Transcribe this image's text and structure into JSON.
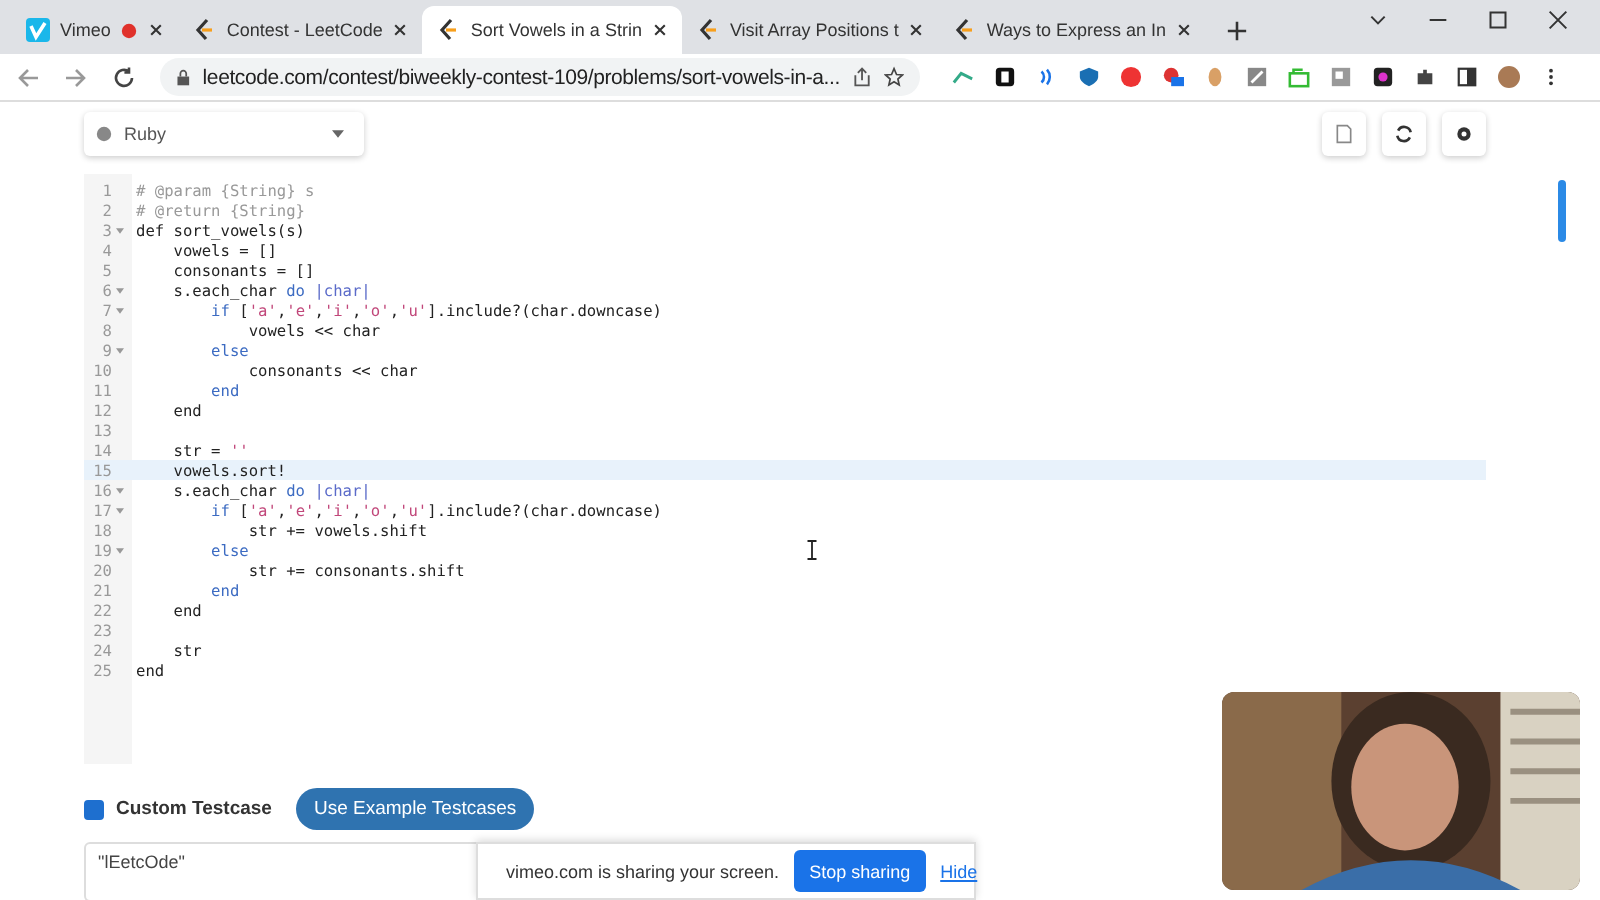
{
  "browser": {
    "tabs": [
      {
        "title": "Vimeo",
        "kind": "video",
        "selected": false,
        "recording": true
      },
      {
        "title": "Contest - LeetCode",
        "kind": "contest",
        "selected": false,
        "recording": false
      },
      {
        "title": "Sort Vowels in a Strin",
        "kind": "contest",
        "selected": true,
        "recording": false
      },
      {
        "title": "Visit Array Positions t",
        "kind": "contest",
        "selected": false,
        "recording": false
      },
      {
        "title": "Ways to Express an In",
        "kind": "contest",
        "selected": false,
        "recording": false
      }
    ],
    "address": "leetcode.com/contest/biweekly-contest-109/problems/sort-vowels-in-a..."
  },
  "toolbar": {
    "language": "Ruby"
  },
  "editor": {
    "lines": [
      {
        "number": "1",
        "fold": false,
        "active": false,
        "segments": [
          {
            "text": "# @param {String} s",
            "kind": "comment"
          }
        ]
      },
      {
        "number": "2",
        "fold": false,
        "active": false,
        "segments": [
          {
            "text": "# @return {String}",
            "kind": "comment"
          }
        ]
      },
      {
        "number": "3",
        "fold": true,
        "active": false,
        "segments": [
          {
            "text": "def sort_vowels(s)",
            "kind": "plain"
          }
        ]
      },
      {
        "number": "4",
        "fold": false,
        "active": false,
        "segments": [
          {
            "text": "    vowels = []",
            "kind": "plain"
          }
        ]
      },
      {
        "number": "5",
        "fold": false,
        "active": false,
        "segments": [
          {
            "text": "    consonants = []",
            "kind": "plain"
          }
        ]
      },
      {
        "number": "6",
        "fold": true,
        "active": false,
        "segments": [
          {
            "text": "    s.each_char ",
            "kind": "plain"
          },
          {
            "text": "do",
            "kind": "keyword"
          },
          {
            "text": " |char|",
            "kind": "variable"
          }
        ]
      },
      {
        "number": "7",
        "fold": true,
        "active": false,
        "segments": [
          {
            "text": "        if",
            "kind": "keyword"
          },
          {
            "text": " [",
            "kind": "plain"
          },
          {
            "text": "'a'",
            "kind": "string"
          },
          {
            "text": ",",
            "kind": "plain"
          },
          {
            "text": "'e'",
            "kind": "string"
          },
          {
            "text": ",",
            "kind": "plain"
          },
          {
            "text": "'i'",
            "kind": "string"
          },
          {
            "text": ",",
            "kind": "plain"
          },
          {
            "text": "'o'",
            "kind": "string"
          },
          {
            "text": ",",
            "kind": "plain"
          },
          {
            "text": "'u'",
            "kind": "string"
          },
          {
            "text": "].include?(char.downcase)",
            "kind": "plain"
          }
        ]
      },
      {
        "number": "8",
        "fold": false,
        "active": false,
        "segments": [
          {
            "text": "            vowels << char",
            "kind": "plain"
          }
        ]
      },
      {
        "number": "9",
        "fold": true,
        "active": false,
        "segments": [
          {
            "text": "        else",
            "kind": "keyword"
          }
        ]
      },
      {
        "number": "10",
        "fold": false,
        "active": false,
        "segments": [
          {
            "text": "            consonants << char",
            "kind": "plain"
          }
        ]
      },
      {
        "number": "11",
        "fold": false,
        "active": false,
        "segments": [
          {
            "text": "        end",
            "kind": "keyword"
          }
        ]
      },
      {
        "number": "12",
        "fold": false,
        "active": false,
        "segments": [
          {
            "text": "    end",
            "kind": "plain"
          }
        ]
      },
      {
        "number": "13",
        "fold": false,
        "active": false
      },
      {
        "number": "14",
        "fold": false,
        "active": false,
        "segments": [
          {
            "text": "    str = ",
            "kind": "plain"
          },
          {
            "text": "''",
            "kind": "string"
          }
        ]
      },
      {
        "number": "15",
        "fold": false,
        "active": true,
        "segments": [
          {
            "text": "    vowels.sort!",
            "kind": "plain"
          }
        ]
      },
      {
        "number": "16",
        "fold": true,
        "active": false,
        "segments": [
          {
            "text": "    s.each_char ",
            "kind": "plain"
          },
          {
            "text": "do",
            "kind": "keyword"
          },
          {
            "text": " |char|",
            "kind": "variable"
          }
        ]
      },
      {
        "number": "17",
        "fold": true,
        "active": false,
        "segments": [
          {
            "text": "        if",
            "kind": "keyword"
          },
          {
            "text": " [",
            "kind": "plain"
          },
          {
            "text": "'a'",
            "kind": "string"
          },
          {
            "text": ",",
            "kind": "plain"
          },
          {
            "text": "'e'",
            "kind": "string"
          },
          {
            "text": ",",
            "kind": "plain"
          },
          {
            "text": "'i'",
            "kind": "string"
          },
          {
            "text": ",",
            "kind": "plain"
          },
          {
            "text": "'o'",
            "kind": "string"
          },
          {
            "text": ",",
            "kind": "plain"
          },
          {
            "text": "'u'",
            "kind": "string"
          },
          {
            "text": "].include?(char.downcase)",
            "kind": "plain"
          }
        ]
      },
      {
        "number": "18",
        "fold": false,
        "active": false,
        "segments": [
          {
            "text": "            str += vowels.shift",
            "kind": "plain"
          }
        ]
      },
      {
        "number": "19",
        "fold": true,
        "active": false,
        "segments": [
          {
            "text": "        else",
            "kind": "keyword"
          }
        ]
      },
      {
        "number": "20",
        "fold": false,
        "active": false,
        "segments": [
          {
            "text": "            str += consonants.shift",
            "kind": "plain"
          }
        ]
      },
      {
        "number": "21",
        "fold": false,
        "active": false,
        "segments": [
          {
            "text": "        end",
            "kind": "keyword"
          }
        ]
      },
      {
        "number": "22",
        "fold": false,
        "active": false,
        "segments": [
          {
            "text": "    end",
            "kind": "plain"
          }
        ]
      },
      {
        "number": "23",
        "fold": false,
        "active": false
      },
      {
        "number": "24",
        "fold": false,
        "active": false,
        "segments": [
          {
            "text": "    str",
            "kind": "plain"
          }
        ]
      },
      {
        "number": "25",
        "fold": false,
        "active": false,
        "segments": [
          {
            "text": "end",
            "kind": "plain"
          }
        ]
      }
    ]
  },
  "testcase": {
    "custom": {
      "label": "Custom Testcase",
      "checked": true
    },
    "example_button": "Use Example Testcases",
    "input": "\"lEetcOde\""
  },
  "share_bar": {
    "message": "vimeo.com is sharing your screen.",
    "stop": "Stop sharing",
    "hide": "Hide"
  }
}
